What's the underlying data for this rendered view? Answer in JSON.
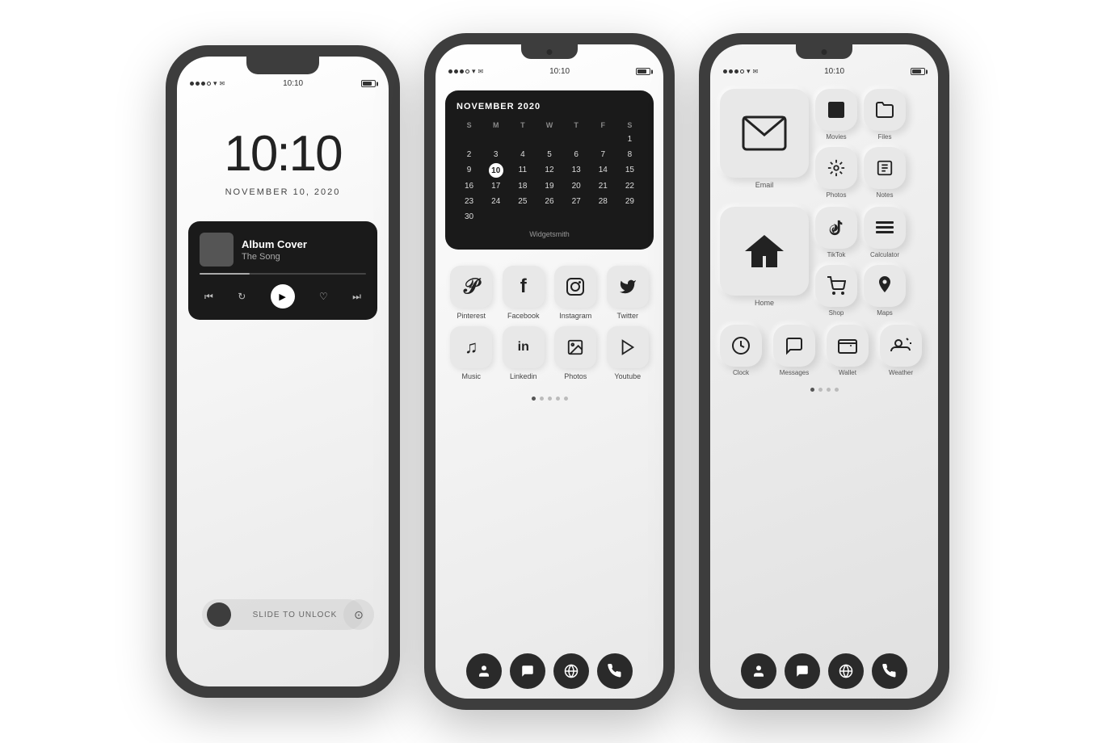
{
  "phone1": {
    "status": {
      "time": "10:10",
      "battery": "80"
    },
    "lock_time": "10:10",
    "lock_date": "NOVEMBER 10, 2020",
    "music": {
      "title": "Album Cover",
      "subtitle": "The Song"
    },
    "unlock_text": "SLIDE TO UNLOCK"
  },
  "phone2": {
    "status": {
      "time": "10:10"
    },
    "calendar": {
      "month_year": "NOVEMBER 2020",
      "day_headers": [
        "S",
        "M",
        "T",
        "W",
        "T",
        "F",
        "S"
      ],
      "days": [
        "",
        "",
        "",
        "",
        "",
        "",
        "1",
        "2",
        "3",
        "4",
        "5",
        "6",
        "7",
        "8",
        "9",
        "10",
        "11",
        "12",
        "13",
        "14",
        "15",
        "16",
        "17",
        "18",
        "19",
        "20",
        "21",
        "22",
        "23",
        "24",
        "25",
        "26",
        "27",
        "28",
        "29",
        "30",
        "",
        ""
      ],
      "today": "10",
      "credit": "Widgetsmith"
    },
    "row1_apps": [
      {
        "label": "Pinterest",
        "icon": "𝓟"
      },
      {
        "label": "Facebook",
        "icon": "f"
      },
      {
        "label": "Instagram",
        "icon": "◫"
      },
      {
        "label": "Twitter",
        "icon": "🐦"
      }
    ],
    "row2_apps": [
      {
        "label": "Music",
        "icon": "♫"
      },
      {
        "label": "Linkedin",
        "icon": "in"
      },
      {
        "label": "Photos",
        "icon": "🖼"
      },
      {
        "label": "Youtube",
        "icon": "▶"
      }
    ],
    "dock": [
      "👤",
      "💬",
      "🌐",
      "📞"
    ]
  },
  "phone3": {
    "status": {
      "time": "10:10"
    },
    "apps_top": [
      {
        "label": "Email",
        "icon": "✉",
        "size": "large"
      },
      {
        "label": "Movies",
        "icon": "🎬",
        "size": "small"
      },
      {
        "label": "Files",
        "icon": "📁",
        "size": "small"
      },
      {
        "label": "Photos",
        "icon": "⚙",
        "size": "small"
      },
      {
        "label": "Notes",
        "icon": "📋",
        "size": "small"
      }
    ],
    "apps_mid": [
      {
        "label": "Home",
        "icon": "🏠",
        "size": "large"
      },
      {
        "label": "TikTok",
        "icon": "♪",
        "size": "small"
      },
      {
        "label": "Calculator",
        "icon": "≡",
        "size": "small"
      },
      {
        "label": "Shop",
        "icon": "🛒",
        "size": "small"
      },
      {
        "label": "Maps",
        "icon": "📍",
        "size": "small"
      }
    ],
    "apps_bot": [
      {
        "label": "Clock",
        "icon": "🕐",
        "size": "small"
      },
      {
        "label": "Messages",
        "icon": "💬",
        "size": "small"
      },
      {
        "label": "Wallet",
        "icon": "💳",
        "size": "small"
      },
      {
        "label": "Weather",
        "icon": "🌤",
        "size": "small"
      }
    ],
    "dock": [
      "👤",
      "💬",
      "🌐",
      "📞"
    ]
  }
}
